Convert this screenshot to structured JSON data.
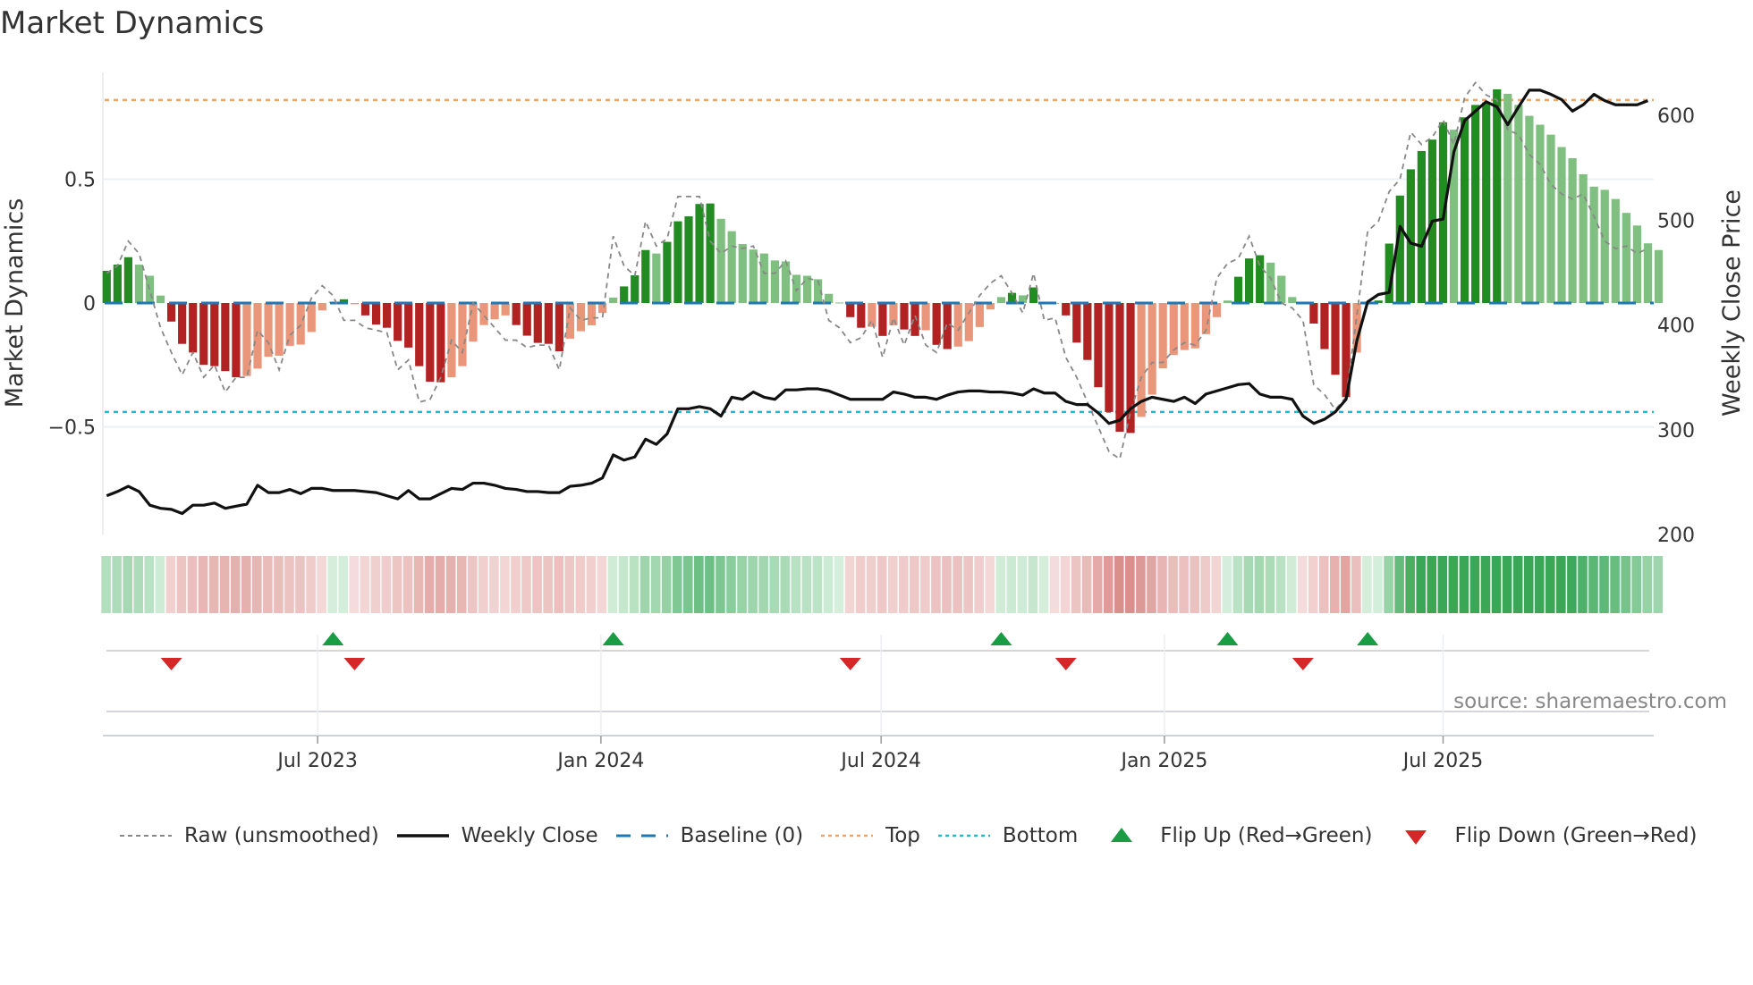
{
  "title": "Market Dynamics",
  "source": "source: sharemaestro.com",
  "colors": {
    "up_strong": "#228b22",
    "up_weak": "#7fbf7f",
    "down_strong": "#b22222",
    "down_weak": "#e9967a",
    "price": "#111111",
    "raw": "#888888",
    "baseline": "#1f77b4",
    "top": "#f4a460",
    "bottom": "#17becf",
    "flip_up": "#1a9c44",
    "flip_down": "#d62728"
  },
  "legend": [
    {
      "key": "raw",
      "label": "Raw (unsmoothed)"
    },
    {
      "key": "price",
      "label": "Weekly Close"
    },
    {
      "key": "baseline",
      "label": "Baseline (0)"
    },
    {
      "key": "top",
      "label": "Top"
    },
    {
      "key": "bottom",
      "label": "Bottom"
    },
    {
      "key": "flip_up",
      "label": "Flip Up (Red→Green)"
    },
    {
      "key": "flip_down",
      "label": "Flip Down (Green→Red)"
    }
  ],
  "chart_data": {
    "type": "bar",
    "title": "Market Dynamics",
    "ylabel": "Market Dynamics",
    "y2label": "Weekly Close Price",
    "frequency": "weekly",
    "start_date": "2023-02-14",
    "ylim": [
      -0.95,
      0.98
    ],
    "y2lim": [
      200,
      640
    ],
    "yticks": [
      {
        "v": 0.5,
        "label": "0.5"
      },
      {
        "v": 0,
        "label": "0"
      },
      {
        "v": -0.5,
        "label": "−0.5"
      }
    ],
    "y2ticks": [
      {
        "v": 600,
        "label": "600"
      },
      {
        "v": 500,
        "label": "500"
      },
      {
        "v": 400,
        "label": "400"
      },
      {
        "v": 300,
        "label": "300"
      },
      {
        "v": 200,
        "label": "200"
      }
    ],
    "xticks": [
      {
        "date": "2023-07-01",
        "label": "Jul 2023"
      },
      {
        "date": "2024-01-01",
        "label": "Jan 2024"
      },
      {
        "date": "2024-07-01",
        "label": "Jul 2024"
      },
      {
        "date": "2025-01-01",
        "label": "Jan 2025"
      },
      {
        "date": "2025-07-01",
        "label": "Jul 2025"
      }
    ],
    "top_level": 0.82,
    "bottom_level": -0.44,
    "baseline": 0,
    "grid": true,
    "legend_position": "bottom",
    "dynamics": [
      0.13,
      0.155,
      0.185,
      0.155,
      0.11,
      0.03,
      -0.075,
      -0.165,
      -0.2,
      -0.25,
      -0.255,
      -0.275,
      -0.3,
      -0.295,
      -0.265,
      -0.217,
      -0.213,
      -0.173,
      -0.168,
      -0.117,
      -0.03,
      0.005,
      0.015,
      -0.005,
      -0.05,
      -0.087,
      -0.1,
      -0.153,
      -0.18,
      -0.255,
      -0.318,
      -0.32,
      -0.3,
      -0.255,
      -0.156,
      -0.089,
      -0.066,
      -0.05,
      -0.089,
      -0.132,
      -0.161,
      -0.165,
      -0.195,
      -0.144,
      -0.114,
      -0.09,
      -0.04,
      0.022,
      0.067,
      0.112,
      0.214,
      0.2,
      0.247,
      0.33,
      0.35,
      0.4,
      0.402,
      0.34,
      0.29,
      0.238,
      0.216,
      0.2,
      0.172,
      0.168,
      0.114,
      0.11,
      0.096,
      0.037,
      0.002,
      -0.057,
      -0.1,
      -0.096,
      -0.133,
      -0.09,
      -0.107,
      -0.133,
      -0.11,
      -0.169,
      -0.186,
      -0.176,
      -0.154,
      -0.097,
      -0.026,
      0.024,
      0.041,
      0.031,
      0.063,
      0.005,
      -0.003,
      -0.05,
      -0.16,
      -0.23,
      -0.34,
      -0.44,
      -0.52,
      -0.525,
      -0.46,
      -0.37,
      -0.264,
      -0.21,
      -0.19,
      -0.183,
      -0.126,
      -0.057,
      0.01,
      0.106,
      0.18,
      0.193,
      0.163,
      0.11,
      0.024,
      -0.003,
      -0.083,
      -0.186,
      -0.29,
      -0.38,
      -0.2,
      0.005,
      0.01,
      0.24,
      0.434,
      0.54,
      0.614,
      0.66,
      0.73,
      0.7,
      0.75,
      0.8,
      0.81,
      0.863,
      0.845,
      0.8,
      0.756,
      0.72,
      0.68,
      0.63,
      0.585,
      0.52,
      0.47,
      0.457,
      0.42,
      0.364,
      0.313,
      0.241,
      0.214
    ],
    "raw": [
      0.12,
      0.15,
      0.25,
      0.2,
      0.05,
      -0.1,
      -0.2,
      -0.29,
      -0.2,
      -0.3,
      -0.25,
      -0.36,
      -0.3,
      -0.3,
      -0.11,
      -0.16,
      -0.27,
      -0.13,
      -0.09,
      0.02,
      0.07,
      0.03,
      -0.07,
      -0.07,
      -0.1,
      -0.11,
      -0.12,
      -0.27,
      -0.23,
      -0.4,
      -0.39,
      -0.3,
      -0.15,
      -0.2,
      0.0,
      -0.05,
      -0.1,
      -0.15,
      -0.15,
      -0.18,
      -0.17,
      -0.17,
      -0.27,
      -0.02,
      -0.07,
      -0.06,
      -0.06,
      0.27,
      0.15,
      0.11,
      0.33,
      0.23,
      0.26,
      0.43,
      0.43,
      0.43,
      0.25,
      0.2,
      0.23,
      0.22,
      0.23,
      0.12,
      0.12,
      0.17,
      0.05,
      0.1,
      0.09,
      -0.07,
      -0.1,
      -0.16,
      -0.14,
      -0.07,
      -0.22,
      -0.06,
      -0.17,
      -0.05,
      -0.17,
      -0.2,
      -0.08,
      -0.11,
      -0.04,
      0.03,
      0.08,
      0.11,
      0.04,
      -0.04,
      0.12,
      -0.07,
      -0.06,
      -0.22,
      -0.3,
      -0.4,
      -0.5,
      -0.6,
      -0.63,
      -0.44,
      -0.3,
      -0.24,
      -0.24,
      -0.19,
      -0.16,
      -0.17,
      -0.11,
      0.1,
      0.16,
      0.18,
      0.27,
      0.15,
      0.1,
      0.0,
      -0.02,
      -0.07,
      -0.33,
      -0.37,
      -0.43,
      -0.38,
      -0.05,
      0.29,
      0.33,
      0.45,
      0.5,
      0.69,
      0.64,
      0.67,
      0.74,
      0.64,
      0.83,
      0.89,
      0.84,
      0.82,
      0.7,
      0.68,
      0.6,
      0.56,
      0.48,
      0.44,
      0.42,
      0.44,
      0.35,
      0.25,
      0.22,
      0.23,
      0.2,
      0.22
    ],
    "weekly_close": [
      237,
      241,
      246,
      241,
      228,
      225,
      224,
      220,
      228,
      228,
      230,
      225,
      227,
      229,
      247,
      240,
      240,
      243,
      239,
      244,
      244,
      242,
      242,
      242,
      241,
      240,
      237,
      234,
      242,
      234,
      234,
      239,
      244,
      243,
      249,
      249,
      247,
      244,
      243,
      241,
      241,
      240,
      240,
      246,
      247,
      249,
      254,
      276,
      271,
      274,
      291,
      286,
      296,
      320,
      320,
      322,
      320,
      313,
      331,
      329,
      336,
      331,
      329,
      338,
      338,
      339,
      339,
      337,
      333,
      329,
      329,
      329,
      329,
      336,
      334,
      331,
      331,
      329,
      333,
      336,
      337,
      337,
      336,
      336,
      335,
      333,
      339,
      335,
      335,
      327,
      324,
      324,
      316,
      306,
      309,
      320,
      327,
      331,
      329,
      327,
      331,
      325,
      334,
      337,
      340,
      343,
      344,
      334,
      331,
      331,
      329,
      313,
      306,
      310,
      317,
      329,
      385,
      422,
      429,
      431,
      494,
      478,
      475,
      499,
      501,
      565,
      595,
      604,
      613,
      608,
      591,
      608,
      624,
      624,
      620,
      615,
      604,
      610,
      620,
      614,
      610,
      610,
      610,
      614
    ],
    "flip_up_weeks": [
      21,
      47,
      83,
      104,
      117
    ],
    "flip_down_weeks": [
      6,
      23,
      69,
      89,
      111
    ]
  }
}
